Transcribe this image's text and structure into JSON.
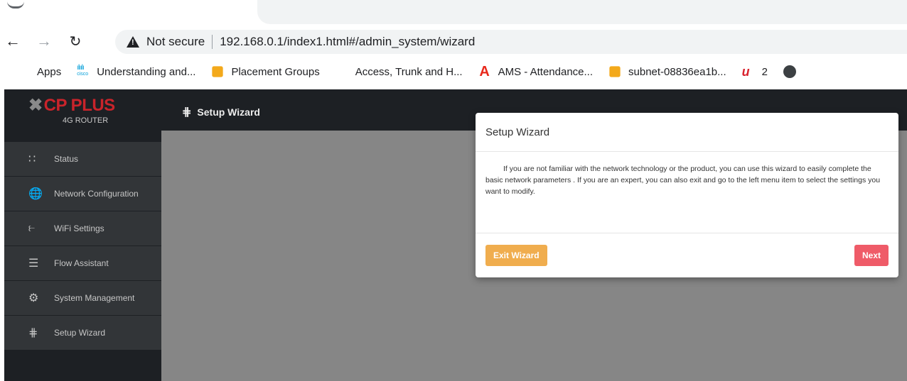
{
  "browser": {
    "address": {
      "security_label": "Not secure",
      "url": "192.168.0.1/index1.html#/admin_system/wizard"
    },
    "bookmarks": [
      {
        "label": "Apps",
        "icon": "apps-grid-icon"
      },
      {
        "label": "Understanding and...",
        "icon": "cisco-icon"
      },
      {
        "label": "Placement Groups",
        "icon": "aws-cube-icon"
      },
      {
        "label": "Access, Trunk and H...",
        "icon": "microsoft-icon"
      },
      {
        "label": "AMS - Attendance...",
        "icon": "ams-a-icon"
      },
      {
        "label": "subnet-08836ea1b...",
        "icon": "aws-cube-icon"
      },
      {
        "label": "2",
        "icon": "u-logo-icon"
      }
    ]
  },
  "router": {
    "logo": {
      "brand": "CP PLUS",
      "sub": "4G ROUTER"
    },
    "header_title": "Setup Wizard",
    "menu": [
      {
        "label": "Status",
        "icon": "grid-icon"
      },
      {
        "label": "Network Configuration",
        "icon": "globe-icon"
      },
      {
        "label": "WiFi Settings",
        "icon": "wifi-icon"
      },
      {
        "label": "Flow Assistant",
        "icon": "sliders-icon"
      },
      {
        "label": "System Management",
        "icon": "gear-icon"
      },
      {
        "label": "Setup Wizard",
        "icon": "wizard-icon"
      }
    ],
    "colors": {
      "brand_red": "#c9242b",
      "sidebar_bg": "#1d2024",
      "content_bg": "#868686"
    }
  },
  "modal": {
    "title": "Setup Wizard",
    "body": "If you are not familiar with the network technology or the product, you can use this wizard to easily complete the basic network parameters . If you are an expert, you can also exit and go to the left menu item to select the settings you want to modify.",
    "exit_label": "Exit Wizard",
    "next_label": "Next",
    "colors": {
      "exit": "#f0ad4e",
      "next": "#ef5b68"
    }
  }
}
